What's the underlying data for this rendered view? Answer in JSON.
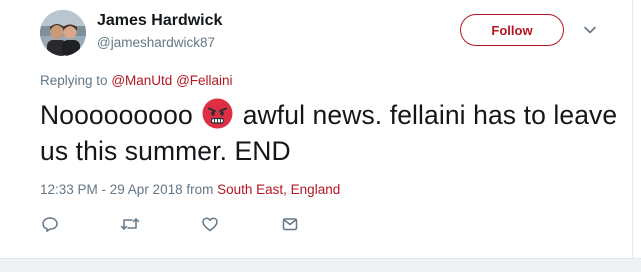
{
  "user": {
    "name": "James Hardwick",
    "handle": "@jameshardwick87",
    "avatar_icon": "profile-photo-couple"
  },
  "follow_button": {
    "label": "Follow",
    "color": "#b41722"
  },
  "reply": {
    "prefix": "Replying to",
    "mentions": [
      "@ManUtd",
      "@Fellaini"
    ]
  },
  "tweet": {
    "text_before_emoji": "Nooooooooo",
    "emoji": "angry-face-emoji",
    "text_after_emoji": "awful news. fellaini has to leave us this summer. END"
  },
  "meta": {
    "timestamp": "12:33 PM - 29 Apr 2018",
    "from_label": "from",
    "location": "South East, England"
  },
  "actions": [
    "reply-icon",
    "retweet-icon",
    "like-icon",
    "direct-message-icon"
  ],
  "colors": {
    "accent": "#b41722",
    "secondary_text": "#657786",
    "primary_text": "#14171a"
  }
}
